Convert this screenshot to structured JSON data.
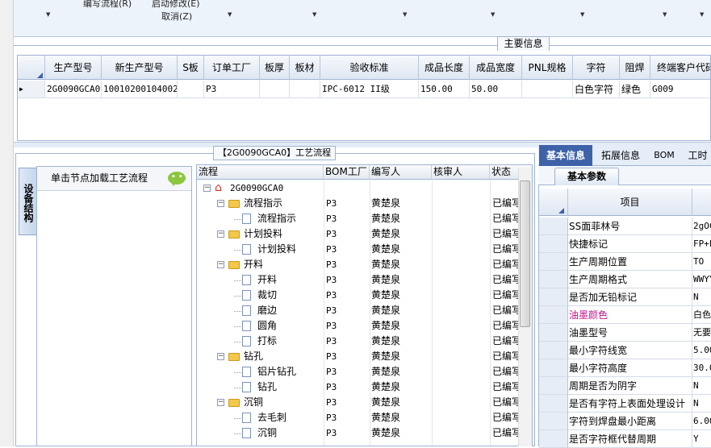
{
  "toolbar": {
    "items": [
      {
        "label": "编写流程(R)"
      },
      {
        "label": "启动修改(E)"
      },
      {
        "label": "取消(Z)"
      }
    ]
  },
  "main_info": {
    "title": "主要信息",
    "columns": [
      "生产型号",
      "新生产型号",
      "S板",
      "订单工厂",
      "板厚",
      "板材",
      "验收标准",
      "成品长度",
      "成品宽度",
      "PNL规格",
      "字符",
      "阻焊",
      "终端客户代码"
    ],
    "row": [
      "2G0090GCA0",
      "10010200104002",
      "",
      "P3",
      "",
      "",
      "IPC-6012 II级",
      "150.00",
      "50.00",
      "",
      "白色字符",
      "绿色",
      "G009"
    ]
  },
  "flow_panel": {
    "title": "【2G0090GCA0】工艺流程",
    "vertical_tab": "设备结构",
    "node_hint": "单击节点加载工艺流程",
    "columns": [
      "流程",
      "BOM工厂",
      "编写人",
      "核审人",
      "状态"
    ],
    "rows": [
      {
        "name": "2G0090GCA0",
        "factory": "",
        "author": "",
        "reviewer": "",
        "status": ""
      },
      {
        "name": "流程指示",
        "factory": "P3",
        "author": "黄楚泉",
        "reviewer": "",
        "status": "已编写"
      },
      {
        "name": "流程指示",
        "factory": "P3",
        "author": "黄楚泉",
        "reviewer": "",
        "status": "已编写"
      },
      {
        "name": "计划投料",
        "factory": "P3",
        "author": "黄楚泉",
        "reviewer": "",
        "status": "已编写"
      },
      {
        "name": "计划投料",
        "factory": "P3",
        "author": "黄楚泉",
        "reviewer": "",
        "status": "已编写"
      },
      {
        "name": "开料",
        "factory": "P3",
        "author": "黄楚泉",
        "reviewer": "",
        "status": "已编写"
      },
      {
        "name": "开料",
        "factory": "P3",
        "author": "黄楚泉",
        "reviewer": "",
        "status": "已编写"
      },
      {
        "name": "裁切",
        "factory": "P3",
        "author": "黄楚泉",
        "reviewer": "",
        "status": "已编写"
      },
      {
        "name": "磨边",
        "factory": "P3",
        "author": "黄楚泉",
        "reviewer": "",
        "status": "已编写"
      },
      {
        "name": "圆角",
        "factory": "P3",
        "author": "黄楚泉",
        "reviewer": "",
        "status": "已编写"
      },
      {
        "name": "打标",
        "factory": "P3",
        "author": "黄楚泉",
        "reviewer": "",
        "status": "已编写"
      },
      {
        "name": "钻孔",
        "factory": "P3",
        "author": "黄楚泉",
        "reviewer": "",
        "status": "已编写"
      },
      {
        "name": "铝片钻孔",
        "factory": "P3",
        "author": "黄楚泉",
        "reviewer": "",
        "status": "已编写"
      },
      {
        "name": "钻孔",
        "factory": "P3",
        "author": "黄楚泉",
        "reviewer": "",
        "status": "已编写"
      },
      {
        "name": "沉铜",
        "factory": "P3",
        "author": "黄楚泉",
        "reviewer": "",
        "status": "已编写"
      },
      {
        "name": "去毛刺",
        "factory": "P3",
        "author": "黄楚泉",
        "reviewer": "",
        "status": "已编写"
      },
      {
        "name": "沉铜",
        "factory": "P3",
        "author": "黄楚泉",
        "reviewer": "",
        "status": "已编写"
      }
    ]
  },
  "right_panel": {
    "tabs": [
      "基本信息",
      "拓展信息",
      "BOM",
      "工时"
    ],
    "subtab": "基本参数",
    "column_header": "项目",
    "properties": [
      {
        "name": "SS面菲林号",
        "value": "2gOC",
        "color": "#000000"
      },
      {
        "name": "快捷标记",
        "value": "FP+L",
        "color": "#000000"
      },
      {
        "name": "生产周期位置",
        "value": "TO",
        "color": "#000000"
      },
      {
        "name": "生产周期格式",
        "value": "WWYY",
        "color": "#000000"
      },
      {
        "name": "是否加无铅标记",
        "value": "N",
        "color": "#000000"
      },
      {
        "name": "油墨颜色",
        "value": "白色",
        "color": "#c0168c"
      },
      {
        "name": "油墨型号",
        "value": "无要",
        "color": "#000000"
      },
      {
        "name": "最小字符线宽",
        "value": "5.00",
        "color": "#000000"
      },
      {
        "name": "最小字符高度",
        "value": "30.0",
        "color": "#000000"
      },
      {
        "name": "周期是否为阴字",
        "value": "N",
        "color": "#000000"
      },
      {
        "name": "是否有字符上表面处理设计",
        "value": "N",
        "color": "#000000"
      },
      {
        "name": "字符到焊盘最小距离",
        "value": "6.00",
        "color": "#000000"
      },
      {
        "name": "是否字符框代替周期",
        "value": "Y",
        "color": "#000000"
      }
    ]
  }
}
